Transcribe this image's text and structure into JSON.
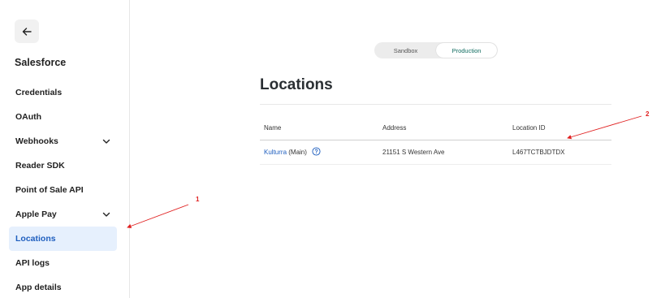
{
  "sidebar": {
    "back_icon": "arrow-left-icon",
    "app_title": "Salesforce",
    "items": [
      {
        "label": "Credentials"
      },
      {
        "label": "OAuth"
      },
      {
        "label": "Webhooks",
        "expandable": true
      },
      {
        "label": "Reader SDK"
      },
      {
        "label": "Point of Sale API"
      },
      {
        "label": "Apple Pay",
        "expandable": true
      },
      {
        "label": "Locations",
        "active": true
      },
      {
        "label": "API logs"
      },
      {
        "label": "App details"
      }
    ]
  },
  "environment_toggle": {
    "options": [
      "Sandbox",
      "Production"
    ],
    "selected": "Production"
  },
  "main": {
    "title": "Locations",
    "table": {
      "columns": [
        "Name",
        "Address",
        "Location ID"
      ],
      "rows": [
        {
          "name": "Kulturra",
          "suffix": "(Main)",
          "address": "21151 S Western Ave",
          "location_id": "L467TCTBJDTDX"
        }
      ]
    }
  },
  "annotations": [
    {
      "label": "1"
    },
    {
      "label": "2"
    }
  ],
  "colors": {
    "accent": "#1f5fbf",
    "active_bg": "#e6f0fd",
    "production_text": "#0f6b5f",
    "annotation": "#e02020"
  }
}
